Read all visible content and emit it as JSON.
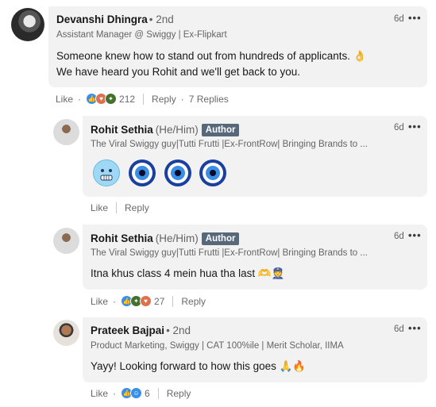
{
  "comments": [
    {
      "name": "Devanshi Dhingra",
      "degree": "• 2nd",
      "headline": "Assistant Manager @ Swiggy | Ex-Flipkart",
      "time": "6d",
      "text_line1": "Someone knew how to stand out from hundreds of applicants. 👌",
      "text_line2": "We have heard you Rohit and we'll get back to you.",
      "like_label": "Like",
      "reaction_count": "212",
      "reply_label": "Reply",
      "replies_label": "7 Replies"
    },
    {
      "name": "Rohit Sethia",
      "pronouns": "(He/Him)",
      "badge": "Author",
      "headline": "The Viral Swiggy guy|Tutti Frutti |Ex-FrontRow| Bringing Brands to ...",
      "time": "6d",
      "like_label": "Like",
      "reply_label": "Reply"
    },
    {
      "name": "Rohit Sethia",
      "pronouns": "(He/Him)",
      "badge": "Author",
      "headline": "The Viral Swiggy guy|Tutti Frutti |Ex-FrontRow| Bringing Brands to ...",
      "time": "6d",
      "text": "Itna khus class 4 mein hua tha last 🫶👮",
      "like_label": "Like",
      "reaction_count": "27",
      "reply_label": "Reply"
    },
    {
      "name": "Prateek Bajpai",
      "degree": "• 2nd",
      "headline": "Product Marketing, Swiggy | CAT 100%ile | Merit Scholar, IIMA",
      "time": "6d",
      "text": "Yayy! Looking forward to how this goes 🙏🔥",
      "like_label": "Like",
      "reaction_count": "6",
      "reply_label": "Reply"
    }
  ],
  "colors": {
    "like_blue": "#378fe9",
    "celebrate_green": "#44712e",
    "love_red": "#df704d",
    "support_purple": "#a872e8"
  }
}
